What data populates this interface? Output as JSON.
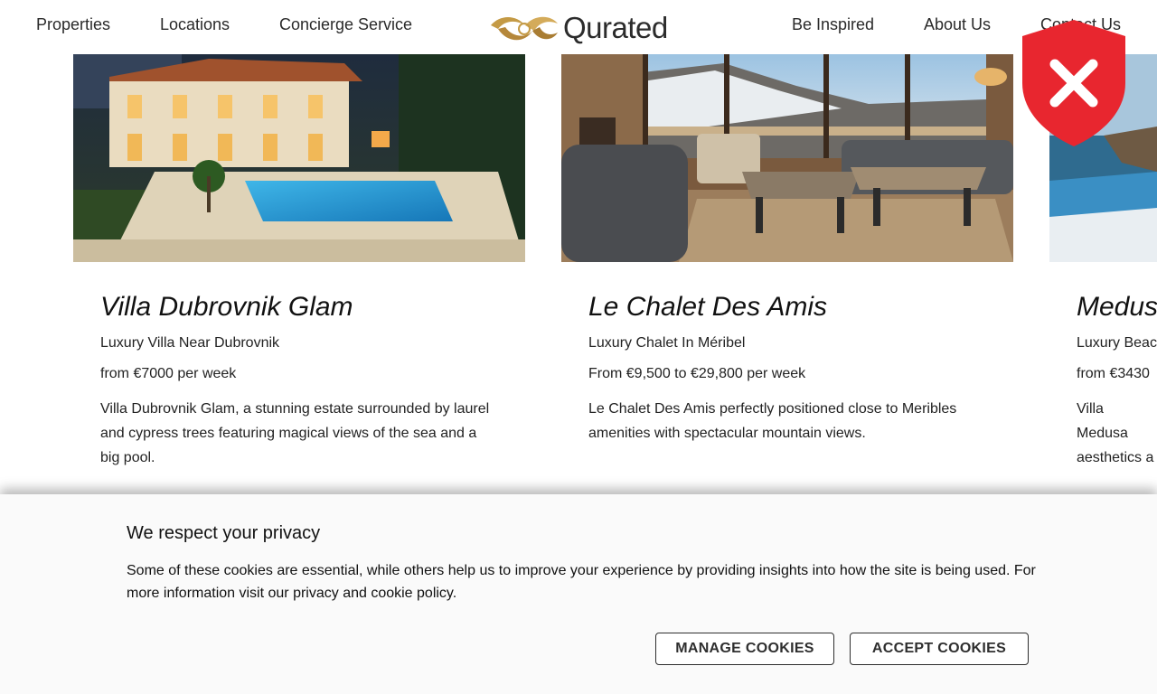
{
  "nav": {
    "left_links": [
      "Properties",
      "Locations",
      "Concierge Service"
    ],
    "right_links": [
      "Be Inspired",
      "About Us",
      "Contact Us"
    ],
    "logo_text": "Qurated"
  },
  "cards": [
    {
      "title": "Villa Dubrovnik Glam",
      "subtitle": "Luxury Villa Near Dubrovnik",
      "price": "from €7000 per week",
      "description": "Villa Dubrovnik Glam, a stunning estate surrounded by laurel and cypress trees featuring magical views of the sea and a big pool.",
      "image": "villa-at-night-with-pool-photo"
    },
    {
      "title": "Le Chalet Des Amis",
      "subtitle": "Luxury Chalet In Méribel",
      "price": "From €9,500 to €29,800 per week",
      "description": "Le Chalet Des Amis perfectly positioned close to Meribles amenities with spectacular mountain views.",
      "image": "chalet-living-room-mountain-view-photo"
    },
    {
      "title": "Medus",
      "subtitle": "Luxury Beac",
      "price": "from €3430",
      "description": "Villa Medusa aesthetics a",
      "image": "infinity-pool-sea-view-photo"
    }
  ],
  "overlay": {
    "icon": "security-shield-x-icon",
    "color": "#e8262f"
  },
  "cookie_banner": {
    "title": "We respect your privacy",
    "text": "Some of these cookies are essential, while others help us to improve your experience by providing insights into how the site is being used. For more information visit our privacy and cookie policy.",
    "manage_label": "MANAGE COOKIES",
    "accept_label": "ACCEPT COOKIES"
  },
  "colors": {
    "logo_gold": "#c49a45",
    "text": "#2a2a2a"
  }
}
